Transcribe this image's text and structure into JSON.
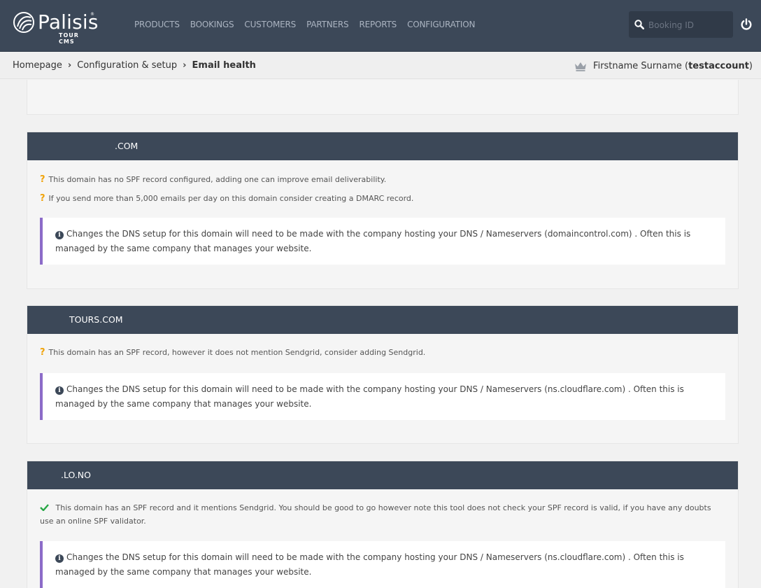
{
  "brand": {
    "name": "Palisis",
    "sub": "TOUR CMS",
    "reg": "®"
  },
  "nav": {
    "items": [
      "PRODUCTS",
      "BOOKINGS",
      "CUSTOMERS",
      "PARTNERS",
      "REPORTS",
      "CONFIGURATION"
    ]
  },
  "search": {
    "placeholder": "Booking ID"
  },
  "breadcrumb": {
    "home": "Homepage",
    "section": "Configuration & setup",
    "current": "Email health"
  },
  "user": {
    "name_prefix": "Firstname Surname (",
    "account": "testaccount",
    "name_suffix": ")"
  },
  "domains": [
    {
      "title": ".COM",
      "messages": [
        {
          "icon": "question",
          "text": "This domain has no SPF record configured, adding one can improve email deliverability."
        },
        {
          "icon": "question",
          "text": "If you send more than 5,000 emails per day on this domain consider creating a DMARC record."
        }
      ],
      "info": "Changes the DNS setup for this domain will need to be made with the company hosting your DNS / Nameservers (domaincontrol.com) . Often this is managed by the same company that manages your website."
    },
    {
      "title": "TOURS.COM",
      "messages": [
        {
          "icon": "question",
          "text": "This domain has an SPF record, however it does not mention Sendgrid, consider adding Sendgrid."
        }
      ],
      "info": "Changes the DNS setup for this domain will need to be made with the company hosting your DNS / Nameservers (ns.cloudflare.com) . Often this is managed by the same company that manages your website."
    },
    {
      "title": ".LO.NO",
      "messages": [
        {
          "icon": "check",
          "text": "This domain has an SPF record and it mentions Sendgrid. You should be good to go however note this tool does not check your SPF record is valid, if you have any doubts use an online SPF validator."
        }
      ],
      "info": "Changes the DNS setup for this domain will need to be made with the company hosting your DNS / Nameservers (ns.cloudflare.com) . Often this is managed by the same company that manages your website."
    }
  ],
  "colors": {
    "header": "#3c4858",
    "accent": "#8c6bc8",
    "question": "#f0a30a",
    "check": "#27a745"
  }
}
